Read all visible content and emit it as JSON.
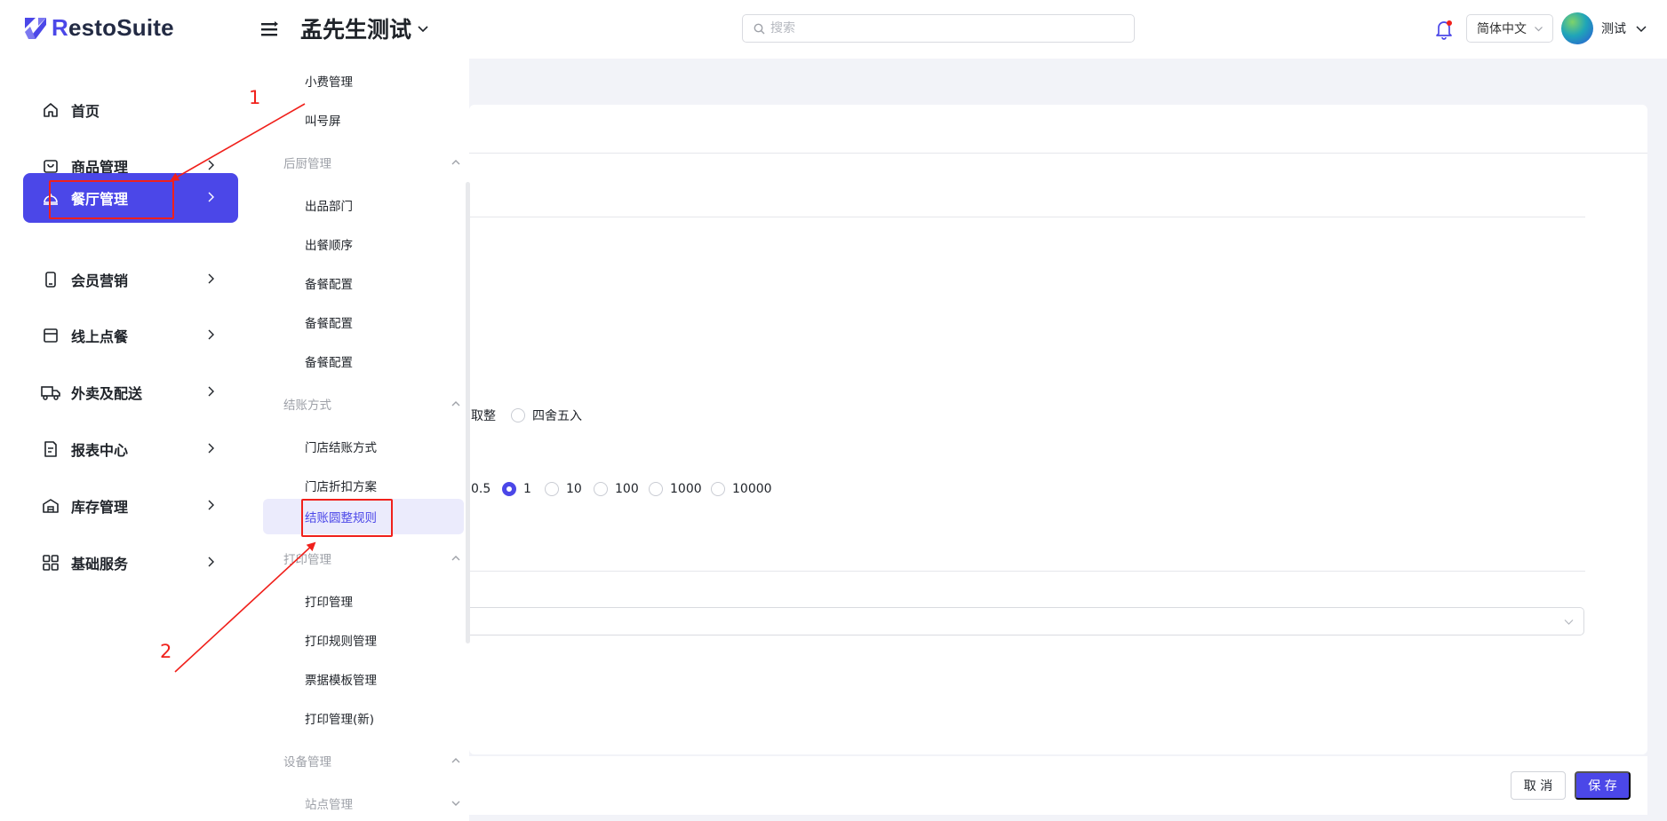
{
  "header": {
    "brand_r": "R",
    "brand_rest": "estoSuite",
    "store_name": "孟先生测试",
    "search_placeholder": "搜索",
    "language": "简体中文",
    "user_name": "测试"
  },
  "sidebar": {
    "items": [
      {
        "label": "首页",
        "icon": "home-icon"
      },
      {
        "label": "商品管理",
        "icon": "shopping-bag-icon"
      },
      {
        "label": "餐厅管理",
        "icon": "cloche-icon",
        "active": true
      },
      {
        "label": "会员营销",
        "icon": "phone-icon"
      },
      {
        "label": "线上点餐",
        "icon": "store-icon"
      },
      {
        "label": "外卖及配送",
        "icon": "truck-icon"
      },
      {
        "label": "报表中心",
        "icon": "report-icon"
      },
      {
        "label": "库存管理",
        "icon": "warehouse-icon"
      },
      {
        "label": "基础服务",
        "icon": "grid-icon"
      }
    ]
  },
  "submenu": {
    "tip_management": "小费管理",
    "queue_screen": "叫号屏",
    "kitchen_group": "后厨管理",
    "kitchen_items": [
      "出品部门",
      "出餐顺序",
      "备餐配置",
      "备餐配置",
      "备餐配置"
    ],
    "checkout_group": "结账方式",
    "checkout_items": [
      "门店结账方式",
      "门店折扣方案",
      "结账圆整规则"
    ],
    "print_group": "打印管理",
    "print_items": [
      "打印管理",
      "打印规则管理",
      "票据模板管理",
      "打印管理(新)"
    ],
    "device_group": "设备管理",
    "station_management": "站点管理"
  },
  "content": {
    "rounding_mode_options": [
      "取整",
      "四舍五入"
    ],
    "precision_options": [
      "0.5",
      "1",
      "10",
      "100",
      "1000",
      "10000"
    ],
    "precision_selected": "1"
  },
  "footer": {
    "cancel_label": "取 消",
    "save_label": "保 存"
  },
  "annotations": {
    "step1": "1",
    "step2": "2"
  },
  "colors": {
    "accent": "#4b47e8",
    "annotation": "#f0201b",
    "active_sub_bg": "#ebebfc"
  }
}
